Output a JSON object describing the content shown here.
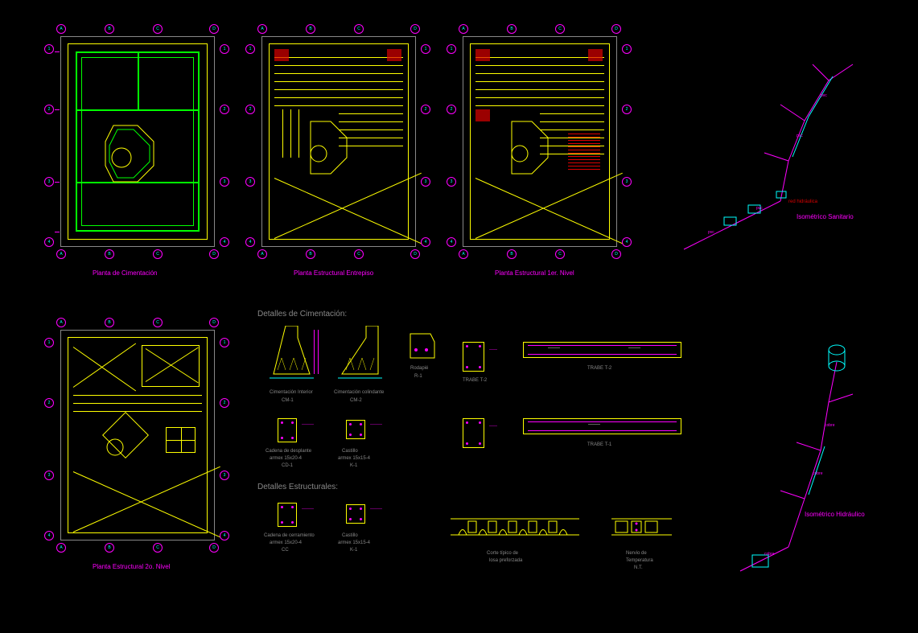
{
  "plans": {
    "cimentacion": {
      "title": "Planta de Cimentación"
    },
    "entrepiso": {
      "title": "Planta Estructural Entrepiso"
    },
    "nivel1": {
      "title": "Planta Estructural 1er. Nivel"
    },
    "nivel2": {
      "title": "Planta Estructural 2o. Nivel"
    }
  },
  "isometrics": {
    "sanitario": {
      "title": "Isométrico Sanitario"
    },
    "hidraulico": {
      "title": "Isométrico Hidráulico"
    }
  },
  "sections": {
    "cimentacion_det": "Detalles de Cimentación:",
    "estructurales_det": "Detalles Estructurales:"
  },
  "details": {
    "cm1": {
      "label": "Cimentación Interior",
      "code": "CM-1"
    },
    "cm2": {
      "label": "Cimentación colindante",
      "code": "CM-2"
    },
    "rodapie": {
      "label": "Rodapié",
      "code": "R-1"
    },
    "cd1": {
      "label": "Cadena de desplante",
      "spec": "armex 15x20-4",
      "code": "CD-1"
    },
    "k1": {
      "label": "Castillo",
      "spec": "armex 15x15-4",
      "code": "K-1"
    },
    "trabe_t2": {
      "label": "TRABE T-2"
    },
    "trabe_t1": {
      "label": "TRABE T-1"
    },
    "cc": {
      "label": "Cadena de cerramiento",
      "spec": "armex 15x20-4",
      "code": "CC"
    },
    "k1b": {
      "label": "Castillo",
      "spec": "armex 15x15-4",
      "code": "K-1"
    },
    "losa": {
      "label": "Corte típico de",
      "sub": "losa preforzada"
    },
    "nervio": {
      "label": "Nervio de",
      "sub": "Temperatura",
      "code": "N.T."
    }
  },
  "grid_labels": [
    "A",
    "B",
    "C",
    "D",
    "1",
    "2",
    "3",
    "4"
  ],
  "annotation": "red hidráulica"
}
